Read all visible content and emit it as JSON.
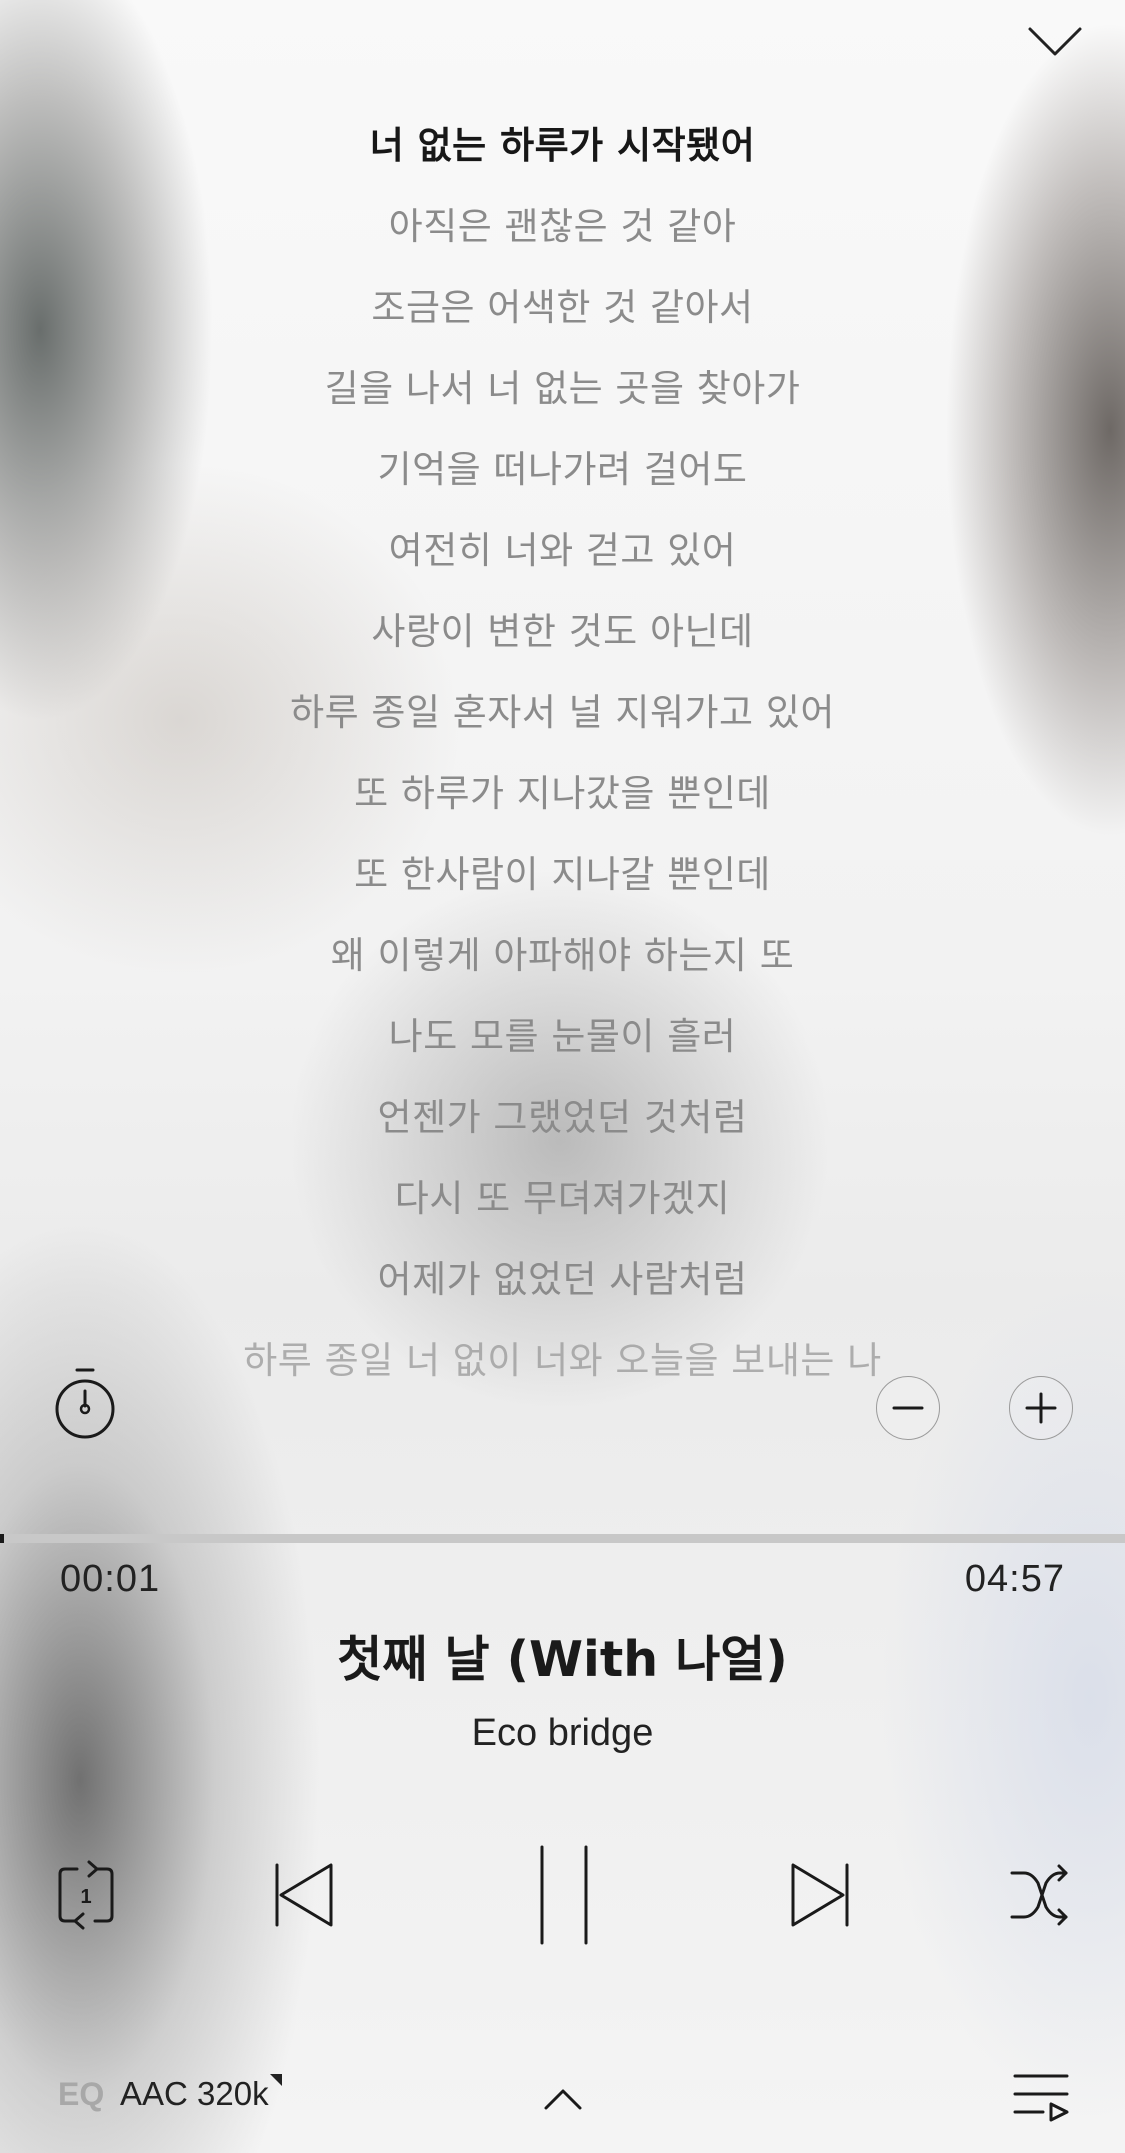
{
  "lyrics": {
    "lines": [
      "너 없는 하루가 시작됐어",
      "아직은 괜찮은 것 같아",
      "조금은 어색한 것 같아서",
      "길을 나서 너 없는 곳을 찾아가",
      "기억을 떠나가려 걸어도",
      "여전히 너와 걷고 있어",
      "사랑이 변한 것도 아닌데",
      "하루 종일 혼자서 널 지워가고 있어",
      "또 하루가 지나갔을 뿐인데",
      "또 한사람이 지나갈 뿐인데",
      "왜 이렇게 아파해야 하는지 또",
      "나도 모를 눈물이 흘러",
      "언젠가 그랬었던 것처럼",
      "다시 또 무뎌져가겠지",
      "어제가 없었던 사람처럼",
      "하루 종일 너 없이 너와 오늘을 보내는 나"
    ],
    "current_index": 0
  },
  "player": {
    "elapsed": "00:01",
    "duration": "04:57",
    "progress_fraction": 0.0034,
    "title": "첫째 날 (With 나얼)",
    "artist": "Eco bridge"
  },
  "controls": {
    "repeat_mode": "repeat-one",
    "repeat_badge": "1",
    "state": "playing"
  },
  "bottom": {
    "eq_label": "EQ",
    "quality": "AAC 320k"
  },
  "icons": {
    "collapse": "chevron-down-icon",
    "timer": "stopwatch-icon",
    "zoom_out": "minus-icon",
    "zoom_in": "plus-icon",
    "repeat": "repeat-one-icon",
    "prev": "skip-previous-icon",
    "pause": "pause-icon",
    "next": "skip-next-icon",
    "shuffle": "shuffle-icon",
    "expand": "chevron-up-icon",
    "playlist": "playlist-icon"
  },
  "colors": {
    "text_primary": "#171717",
    "text_lyric": "#8b8b8b",
    "progress_track": "#c8c8c8",
    "progress_fill": "#1a1a1a",
    "eq_label": "#a8a8a8"
  }
}
